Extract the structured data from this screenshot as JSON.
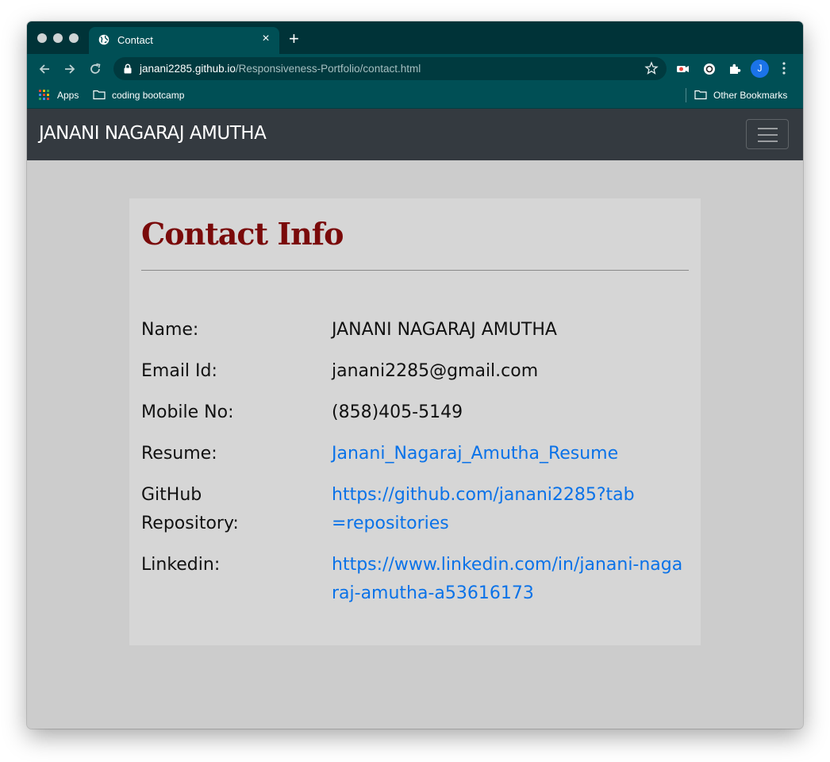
{
  "browser": {
    "tab_title": "Contact",
    "tab_close": "×",
    "new_tab": "+",
    "url_host": "janani2285.github.io",
    "url_path": "/Responsiveness-Portfolio/contact.html",
    "profile_initial": "J",
    "bookmarks": {
      "apps": "Apps",
      "folder": "coding bootcamp",
      "other": "Other Bookmarks"
    },
    "icons": {
      "back": "arrow-left-icon",
      "forward": "arrow-right-icon",
      "reload": "reload-icon",
      "star": "star-icon",
      "menu": "more-vertical-icon"
    },
    "colors": {
      "tabstrip": "#003338",
      "toolbar": "#004f55",
      "omnibox": "#003a3f"
    }
  },
  "navbar": {
    "brand": "JANANI NAGARAJ AMUTHA"
  },
  "contact": {
    "title": "Contact Info",
    "rows": [
      {
        "label": "Name:",
        "value": "JANANI NAGARAJ AMUTHA"
      },
      {
        "label": "Email Id:",
        "value": "janani2285@gmail.com"
      },
      {
        "label": "Mobile No:",
        "value": "(858)405-5149"
      },
      {
        "label": "Resume:",
        "value": "Janani_Nagaraj_Amutha_Resume"
      },
      {
        "label": "GitHub Repository:",
        "value": "https://github.com/janani2285?tab=repositories"
      },
      {
        "label": "Linkedin:",
        "value": "https://www.linkedin.com/in/janani-nagaraj-amutha-a53616173"
      }
    ],
    "colors": {
      "title": "#7a0a0a",
      "link": "#0a72e8",
      "card": "#d6d6d6",
      "page": "#cccccc",
      "navbar": "#343a40"
    }
  }
}
